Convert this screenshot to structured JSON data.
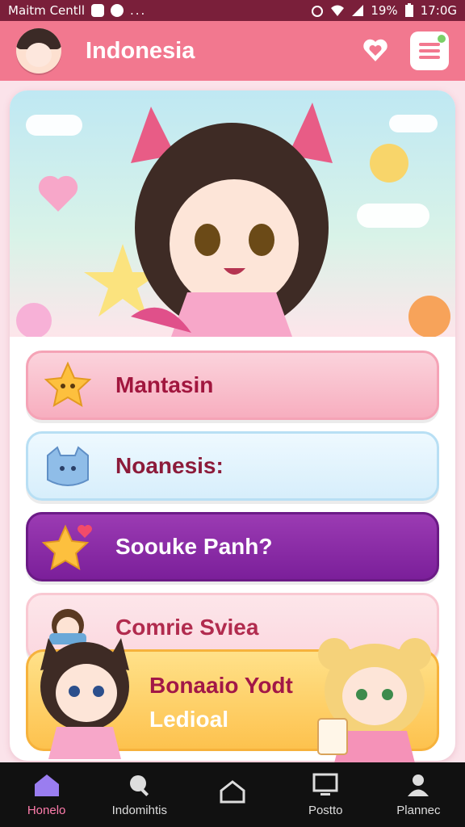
{
  "status_bar": {
    "carrier": "Maitm Centll",
    "overflow": "...",
    "battery": "19%",
    "time": "17:0G"
  },
  "app_bar": {
    "title": "Indonesia",
    "icons": [
      "avatar",
      "heart-icon",
      "menu-icon"
    ]
  },
  "options": [
    {
      "label": "Mantasin",
      "icon": "star-face-icon"
    },
    {
      "label": "Noanesis:",
      "icon": "blue-cat-icon"
    },
    {
      "label": "Soouke Panh?",
      "icon": "star-heart-icon"
    },
    {
      "label": "Comrie Sviea",
      "icon": "character-icon"
    }
  ],
  "feature_card": {
    "line1": "Bonaaio Yodt",
    "line2": "Ledioal"
  },
  "bottom_nav": [
    {
      "label": "Honelo",
      "icon": "home-icon",
      "active": true
    },
    {
      "label": "Indomihtis",
      "icon": "search-icon",
      "active": false
    },
    {
      "label": "",
      "icon": "house-outline-icon",
      "active": false
    },
    {
      "label": "Postto",
      "icon": "screen-icon",
      "active": false
    },
    {
      "label": "Plannec",
      "icon": "person-icon",
      "active": false
    }
  ],
  "colors": {
    "status_bar": "#7a1f3a",
    "app_bar": "#f2788f",
    "accent_purple": "#7b1f9a",
    "active_nav": "#ff7dac"
  }
}
